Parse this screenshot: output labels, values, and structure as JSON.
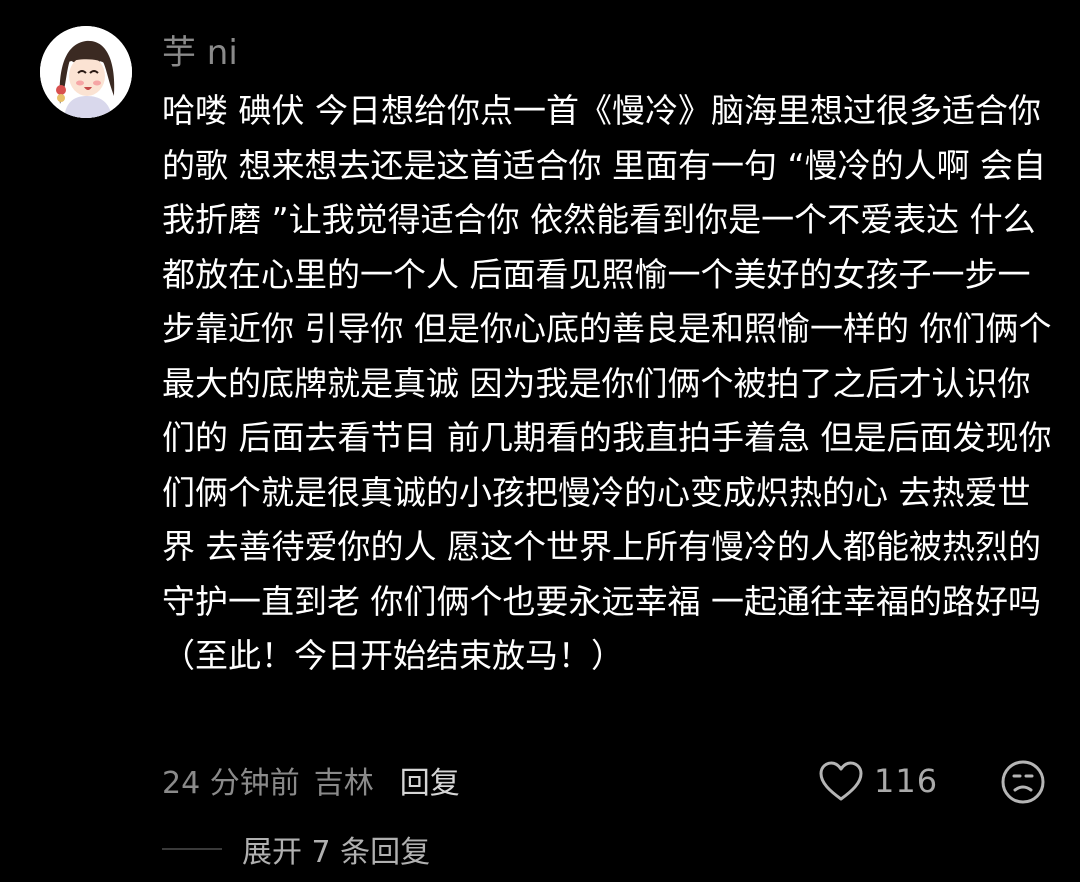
{
  "comment": {
    "username": "芋 ni",
    "text": "哈喽 碘伏 今日想给你点一首《慢冷》脑海里想过很多适合你的歌 想来想去还是这首适合你 里面有一句 “慢冷的人啊 会自我折磨 ”让我觉得适合你 依然能看到你是一个不爱表达 什么都放在心里的一个人 后面看见照愉一个美好的女孩子一步一步靠近你 引导你 但是你心底的善良是和照愉一样的 你们俩个最大的底牌就是真诚 因为我是你们俩个被拍了之后才认识你们的 后面去看节目 前几期看的我直拍手着急 但是后面发现你们俩个就是很真诚的小孩把慢冷的心变成炽热的心 去热爱世界 去善待爱你的人 愿这个世界上所有慢冷的人都能被热烈的守护一直到老 你们俩个也要永远幸福 一起通往幸福的路好吗（至此！今日开始结束放马！）",
    "time": "24 分钟前",
    "location": "吉林",
    "reply_label": "回复",
    "like_count": "116",
    "expand_label": "展开 7 条回复"
  },
  "icons": {
    "avatar": "avatar-cartoon-girl",
    "like": "heart-outline-icon",
    "dislike": "sad-face-icon"
  },
  "colors": {
    "background": "#000000",
    "text": "#ffffff",
    "secondary_text": "#8a8a8a",
    "icon": "#b5b5b5"
  }
}
